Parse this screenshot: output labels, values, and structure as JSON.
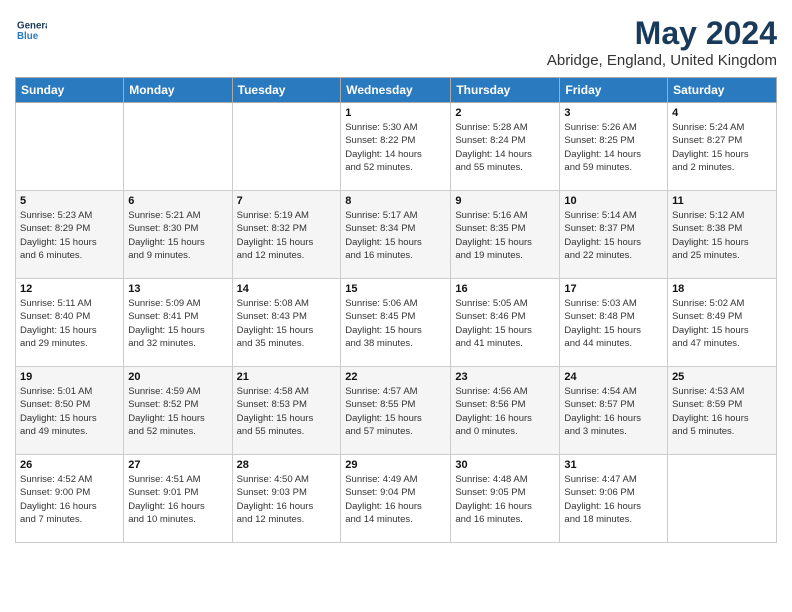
{
  "logo": {
    "line1": "General",
    "line2": "Blue"
  },
  "title": "May 2024",
  "subtitle": "Abridge, England, United Kingdom",
  "days_of_week": [
    "Sunday",
    "Monday",
    "Tuesday",
    "Wednesday",
    "Thursday",
    "Friday",
    "Saturday"
  ],
  "weeks": [
    [
      {
        "day": "",
        "info": ""
      },
      {
        "day": "",
        "info": ""
      },
      {
        "day": "",
        "info": ""
      },
      {
        "day": "1",
        "info": "Sunrise: 5:30 AM\nSunset: 8:22 PM\nDaylight: 14 hours\nand 52 minutes."
      },
      {
        "day": "2",
        "info": "Sunrise: 5:28 AM\nSunset: 8:24 PM\nDaylight: 14 hours\nand 55 minutes."
      },
      {
        "day": "3",
        "info": "Sunrise: 5:26 AM\nSunset: 8:25 PM\nDaylight: 14 hours\nand 59 minutes."
      },
      {
        "day": "4",
        "info": "Sunrise: 5:24 AM\nSunset: 8:27 PM\nDaylight: 15 hours\nand 2 minutes."
      }
    ],
    [
      {
        "day": "5",
        "info": "Sunrise: 5:23 AM\nSunset: 8:29 PM\nDaylight: 15 hours\nand 6 minutes."
      },
      {
        "day": "6",
        "info": "Sunrise: 5:21 AM\nSunset: 8:30 PM\nDaylight: 15 hours\nand 9 minutes."
      },
      {
        "day": "7",
        "info": "Sunrise: 5:19 AM\nSunset: 8:32 PM\nDaylight: 15 hours\nand 12 minutes."
      },
      {
        "day": "8",
        "info": "Sunrise: 5:17 AM\nSunset: 8:34 PM\nDaylight: 15 hours\nand 16 minutes."
      },
      {
        "day": "9",
        "info": "Sunrise: 5:16 AM\nSunset: 8:35 PM\nDaylight: 15 hours\nand 19 minutes."
      },
      {
        "day": "10",
        "info": "Sunrise: 5:14 AM\nSunset: 8:37 PM\nDaylight: 15 hours\nand 22 minutes."
      },
      {
        "day": "11",
        "info": "Sunrise: 5:12 AM\nSunset: 8:38 PM\nDaylight: 15 hours\nand 25 minutes."
      }
    ],
    [
      {
        "day": "12",
        "info": "Sunrise: 5:11 AM\nSunset: 8:40 PM\nDaylight: 15 hours\nand 29 minutes."
      },
      {
        "day": "13",
        "info": "Sunrise: 5:09 AM\nSunset: 8:41 PM\nDaylight: 15 hours\nand 32 minutes."
      },
      {
        "day": "14",
        "info": "Sunrise: 5:08 AM\nSunset: 8:43 PM\nDaylight: 15 hours\nand 35 minutes."
      },
      {
        "day": "15",
        "info": "Sunrise: 5:06 AM\nSunset: 8:45 PM\nDaylight: 15 hours\nand 38 minutes."
      },
      {
        "day": "16",
        "info": "Sunrise: 5:05 AM\nSunset: 8:46 PM\nDaylight: 15 hours\nand 41 minutes."
      },
      {
        "day": "17",
        "info": "Sunrise: 5:03 AM\nSunset: 8:48 PM\nDaylight: 15 hours\nand 44 minutes."
      },
      {
        "day": "18",
        "info": "Sunrise: 5:02 AM\nSunset: 8:49 PM\nDaylight: 15 hours\nand 47 minutes."
      }
    ],
    [
      {
        "day": "19",
        "info": "Sunrise: 5:01 AM\nSunset: 8:50 PM\nDaylight: 15 hours\nand 49 minutes."
      },
      {
        "day": "20",
        "info": "Sunrise: 4:59 AM\nSunset: 8:52 PM\nDaylight: 15 hours\nand 52 minutes."
      },
      {
        "day": "21",
        "info": "Sunrise: 4:58 AM\nSunset: 8:53 PM\nDaylight: 15 hours\nand 55 minutes."
      },
      {
        "day": "22",
        "info": "Sunrise: 4:57 AM\nSunset: 8:55 PM\nDaylight: 15 hours\nand 57 minutes."
      },
      {
        "day": "23",
        "info": "Sunrise: 4:56 AM\nSunset: 8:56 PM\nDaylight: 16 hours\nand 0 minutes."
      },
      {
        "day": "24",
        "info": "Sunrise: 4:54 AM\nSunset: 8:57 PM\nDaylight: 16 hours\nand 3 minutes."
      },
      {
        "day": "25",
        "info": "Sunrise: 4:53 AM\nSunset: 8:59 PM\nDaylight: 16 hours\nand 5 minutes."
      }
    ],
    [
      {
        "day": "26",
        "info": "Sunrise: 4:52 AM\nSunset: 9:00 PM\nDaylight: 16 hours\nand 7 minutes."
      },
      {
        "day": "27",
        "info": "Sunrise: 4:51 AM\nSunset: 9:01 PM\nDaylight: 16 hours\nand 10 minutes."
      },
      {
        "day": "28",
        "info": "Sunrise: 4:50 AM\nSunset: 9:03 PM\nDaylight: 16 hours\nand 12 minutes."
      },
      {
        "day": "29",
        "info": "Sunrise: 4:49 AM\nSunset: 9:04 PM\nDaylight: 16 hours\nand 14 minutes."
      },
      {
        "day": "30",
        "info": "Sunrise: 4:48 AM\nSunset: 9:05 PM\nDaylight: 16 hours\nand 16 minutes."
      },
      {
        "day": "31",
        "info": "Sunrise: 4:47 AM\nSunset: 9:06 PM\nDaylight: 16 hours\nand 18 minutes."
      },
      {
        "day": "",
        "info": ""
      }
    ]
  ]
}
